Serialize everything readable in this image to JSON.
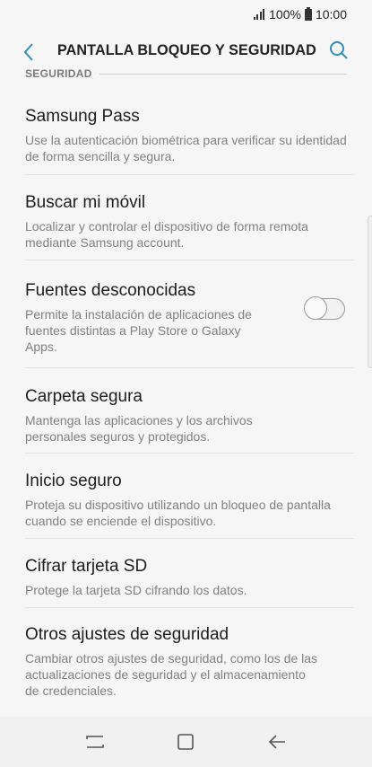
{
  "status_bar": {
    "battery": "100%",
    "time": "10:00"
  },
  "header": {
    "title": "PANTALLA BLOQUEO Y SEGURIDAD",
    "back_icon": "back-arrow-icon",
    "search_icon": "search-icon"
  },
  "section": {
    "label": "SEGURIDAD"
  },
  "items": [
    {
      "title": "Samsung Pass",
      "description": "Use la autenticación biométrica para verificar su identidad de forma sencilla y segura."
    },
    {
      "title": "Buscar mi móvil",
      "description": "Localizar y controlar el dispositivo de forma remota mediante Samsung account."
    },
    {
      "title": "Fuentes desconocidas",
      "description": "Permite la instalación de aplicaciones de fuentes distintas a Play Store o Galaxy Apps.",
      "toggle_on": false
    },
    {
      "title": "Carpeta segura",
      "description": "Mantenga las aplicaciones y los archivos personales seguros y protegidos."
    },
    {
      "title": "Inicio seguro",
      "description": "Proteja su dispositivo utilizando un bloqueo de pantalla cuando se enciende el dispositivo."
    },
    {
      "title": "Cifrar tarjeta SD",
      "description": "Protege la tarjeta SD cifrando los datos."
    },
    {
      "title": "Otros ajustes de seguridad",
      "description": "Cambiar otros ajustes de seguridad, como los de las actualizaciones de seguridad y el almacenamiento de credenciales."
    }
  ],
  "nav_bar": {
    "recents_icon": "recents-icon",
    "home_icon": "home-icon",
    "back_icon": "back-icon"
  },
  "colors": {
    "accent": "#2f8fb5",
    "background": "#f6f6f6"
  }
}
